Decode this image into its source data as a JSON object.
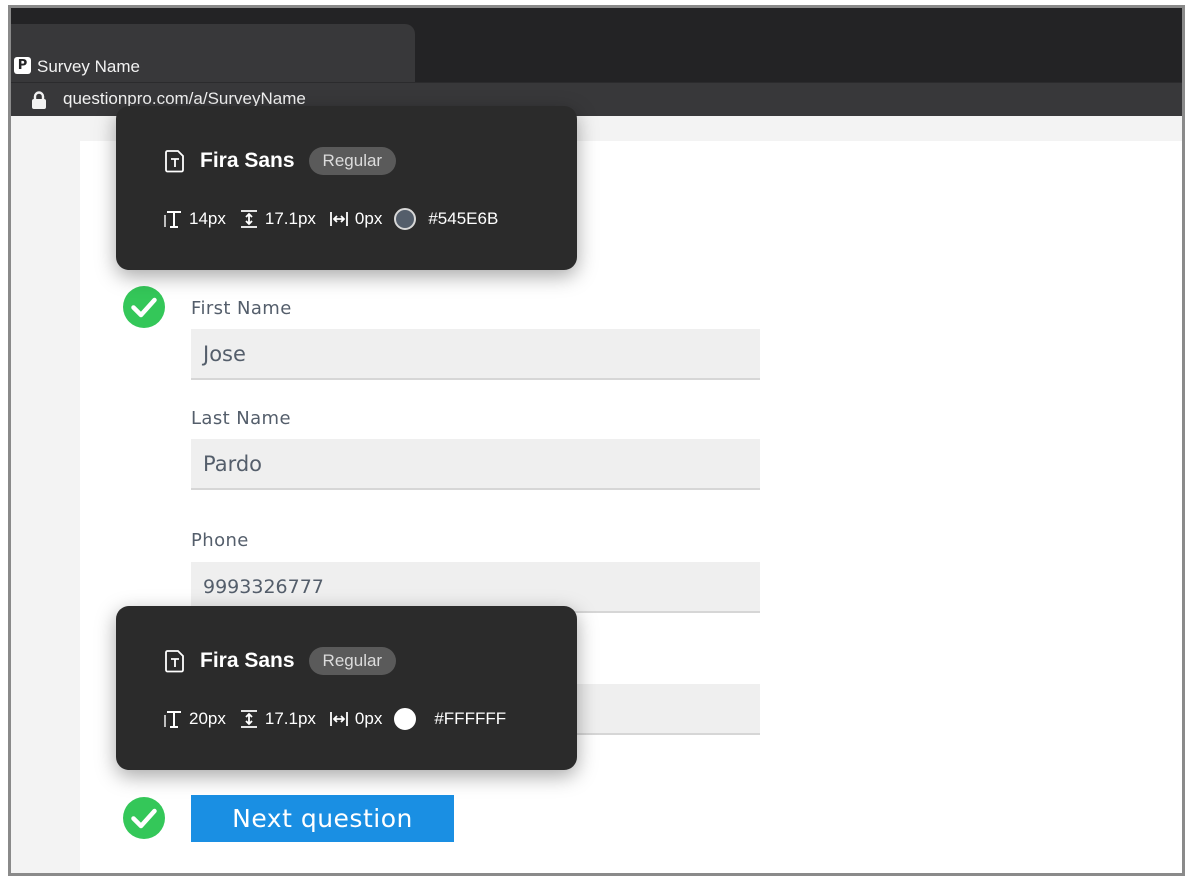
{
  "browser": {
    "tab_title": "Survey Name",
    "favicon_letter": "P",
    "url": "questionpro.com/a/SurveyName"
  },
  "form": {
    "fields": [
      {
        "label": "First Name",
        "value": "Jose"
      },
      {
        "label": "Last Name",
        "value": "Pardo"
      },
      {
        "label": "Phone",
        "value": "9993326777"
      }
    ],
    "next_button_label": "Next question"
  },
  "inspectors": [
    {
      "font_name": "Fira Sans",
      "weight": "Regular",
      "font_size": "14px",
      "line_height": "17.1px",
      "letter_spacing": "0px",
      "color_hex": "#545E6B"
    },
    {
      "font_name": "Fira Sans",
      "weight": "Regular",
      "font_size": "20px",
      "line_height": "17.1px",
      "letter_spacing": "0px",
      "color_hex": "#FFFFFF"
    }
  ],
  "colors": {
    "check_green": "#34c759",
    "button_blue": "#1a8fe3",
    "label_gray": "#545E6B"
  }
}
